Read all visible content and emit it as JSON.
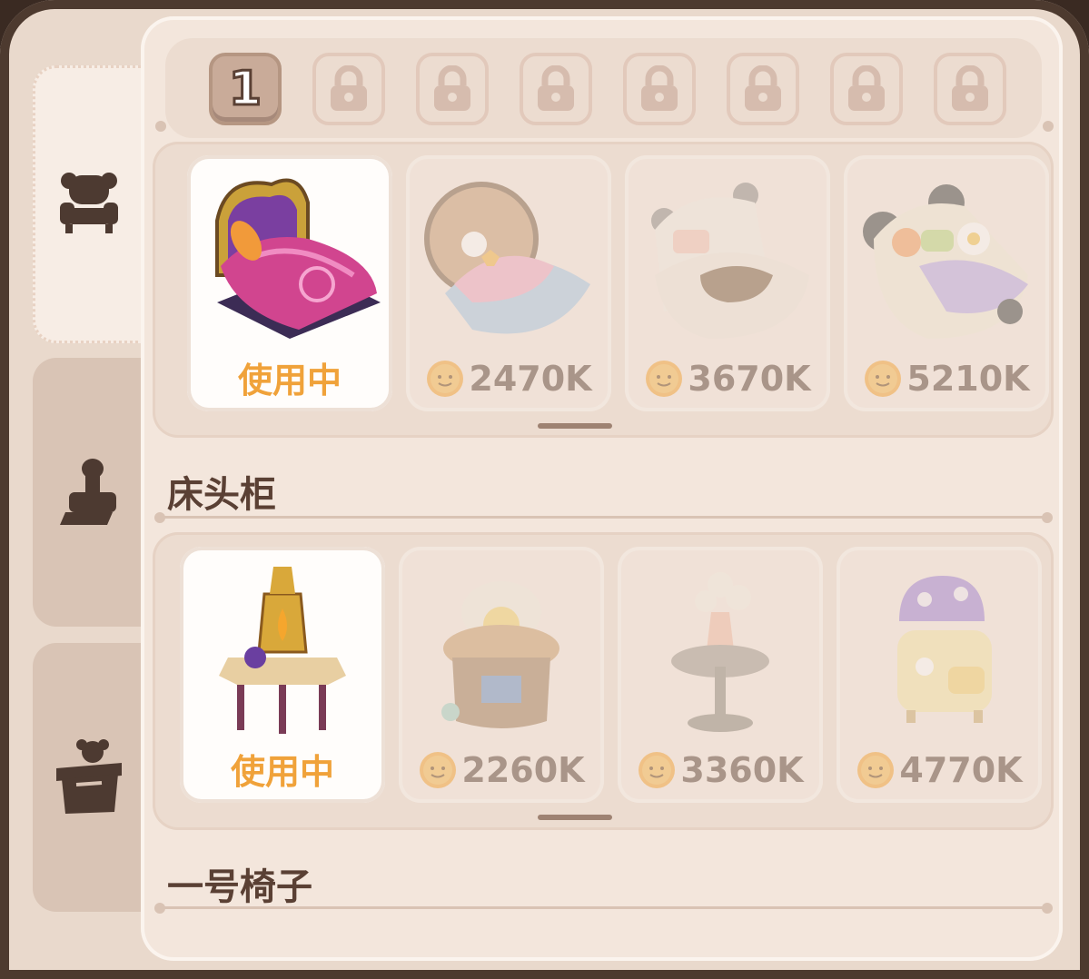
{
  "page_tabs": {
    "current": "1",
    "locked_count": 7
  },
  "side_tabs": [
    {
      "icon": "armchair-icon",
      "active": true
    },
    {
      "icon": "stamp-icon",
      "active": false
    },
    {
      "icon": "teddy-box-icon",
      "active": false
    }
  ],
  "sections": [
    {
      "title": "",
      "items": [
        {
          "status": "使用中",
          "art": "purple-royal-bed"
        },
        {
          "price": "2470K",
          "art": "nest-bed"
        },
        {
          "price": "3670K",
          "art": "cream-bear-bed"
        },
        {
          "price": "5210K",
          "art": "panda-bed"
        }
      ]
    },
    {
      "title": "床头柜",
      "items": [
        {
          "status": "使用中",
          "art": "lantern-table"
        },
        {
          "price": "2260K",
          "art": "nest-lamp-table"
        },
        {
          "price": "3360K",
          "art": "flower-vase-table"
        },
        {
          "price": "4770K",
          "art": "mushroom-cabinet"
        }
      ]
    }
  ],
  "next_section_title": "一号椅子",
  "colors": {
    "in_use_text": "#f0a23a",
    "text_dark": "#5a4034",
    "panel_bg": "#f3e6dc"
  }
}
